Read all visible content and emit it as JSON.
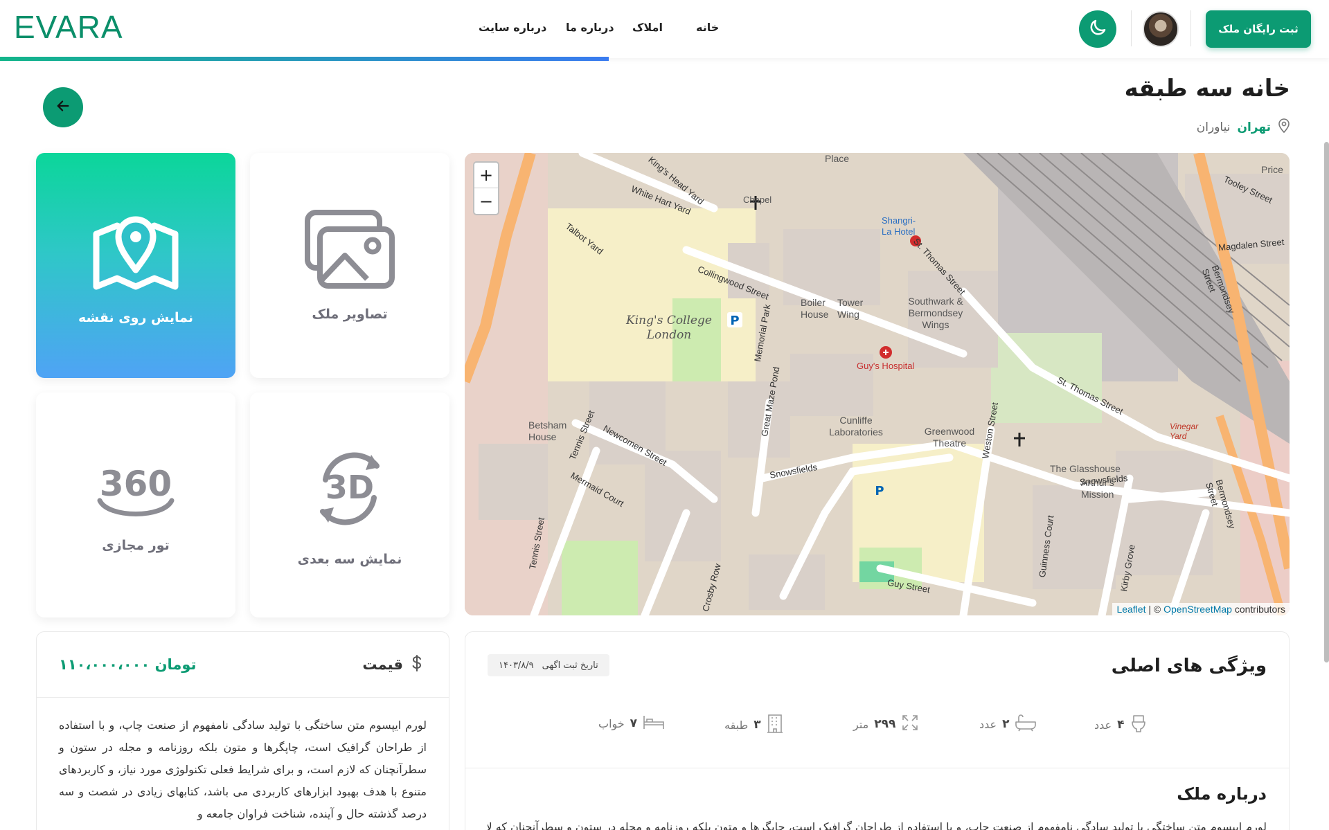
{
  "header": {
    "logo": "EVARA",
    "nav": [
      {
        "label": "خانه"
      },
      {
        "label": "املاک"
      },
      {
        "label": "درباره ما"
      },
      {
        "label": "درباره سایت"
      }
    ],
    "register_label": "ثبت رایگان ملک",
    "theme_icon": "moon-icon",
    "accent_color": "#0c9b73"
  },
  "property": {
    "title": "خانه سه طبقه",
    "city": "تهران",
    "area": "نیاوران"
  },
  "tiles": [
    {
      "label": "نمایش روی نقشه",
      "icon": "map-pin-icon",
      "active": true
    },
    {
      "label": "تصاویر ملک",
      "icon": "images-icon",
      "active": false
    },
    {
      "label": "تور مجازی",
      "icon": "360-icon",
      "active": false
    },
    {
      "label": "نمایش سه بعدی",
      "icon": "3d-icon",
      "active": false
    }
  ],
  "map": {
    "zoom_in": "+",
    "zoom_out": "−",
    "attribution_leaflet": "Leaflet",
    "attribution_sep": " | © ",
    "attribution_osm": "OpenStreetMap",
    "attribution_tail": " contributors",
    "labels": {
      "kings_college": "King's College London",
      "guys_hospital": "Guy's Hospital",
      "st_thomas": "St. Thomas Street",
      "snowsfields": "Snowsfields",
      "newcomen": "Newcomen Street",
      "collingwood": "Collingwood Street",
      "weston": "Weston Street",
      "guy_street": "Guy Street",
      "southwark": "Southwark & Bermondsey Wings",
      "boiler": "Boiler House",
      "tower": "Tower Wing",
      "chapel": "Chapel",
      "white_hart": "White Hart Yard",
      "kings_head": "King's Head Yard",
      "talbot": "Talbot Yard",
      "shangri": "Shangri-La Hotel",
      "memorial_park": "Memorial Park",
      "great_maze": "Great Maze Pond",
      "cunliffe": "Cunliffe Laboratories",
      "greenwood": "Greenwood Theatre",
      "glasshouse": "The Glasshouse",
      "arthurs": "Arthur's Mission",
      "mermaid": "Mermaid Court",
      "betsham": "Betsham House",
      "tennis": "Tennis Street",
      "crosby": "Crosby Row",
      "kirby": "Kirby Grove",
      "guinness": "Guinness Court",
      "bermondsey": "Bermondsey Street",
      "magdalen": "Magdalen Street",
      "tooley": "Tooley Street",
      "vinegar": "Vinegar Yard",
      "place": "Place",
      "price": "Price"
    }
  },
  "price": {
    "label": "قیمت",
    "value": "۱۱۰،۰۰۰،۰۰۰",
    "currency": "تومان",
    "description": "لورم ایپسوم متن ساختگی با تولید سادگی نامفهوم از صنعت چاپ، و با استفاده از طراحان گرافیک است، چاپگرها و متون بلکه روزنامه و مجله در ستون و سطرآنچنان که لازم است، و برای شرایط فعلی تکنولوژی مورد نیاز، و کاربردهای متنوع با هدف بهبود ابزارهای کاربردی می باشد، کتابهای زیادی در شصت و سه درصد گذشته حال و آینده، شناخت فراوان جامعه و"
  },
  "features": {
    "title": "ویژگی های اصلی",
    "date_label": "تاریخ ثبت اگهی",
    "date_value": "۱۴۰۳/۸/۹",
    "items": [
      {
        "icon": "toilet-icon",
        "num": "۴",
        "unit": "عدد"
      },
      {
        "icon": "bathtub-icon",
        "num": "۲",
        "unit": "عدد"
      },
      {
        "icon": "area-icon",
        "num": "۲۹۹",
        "unit": "متر"
      },
      {
        "icon": "building-icon",
        "num": "۳",
        "unit": "طبقه"
      },
      {
        "icon": "bed-icon",
        "num": "۷",
        "unit": "خواب"
      }
    ],
    "about_title": "درباره ملک",
    "about_text": "لورم ایپسوم متن ساختگی با تولید سادگی نامفهوم از صنعت چاپ، و با استفاده از طراحان گرافیک است، چاپگرها و متون بلکه روزنامه و مجله در ستون و سطرآنچنان که لازم است"
  }
}
